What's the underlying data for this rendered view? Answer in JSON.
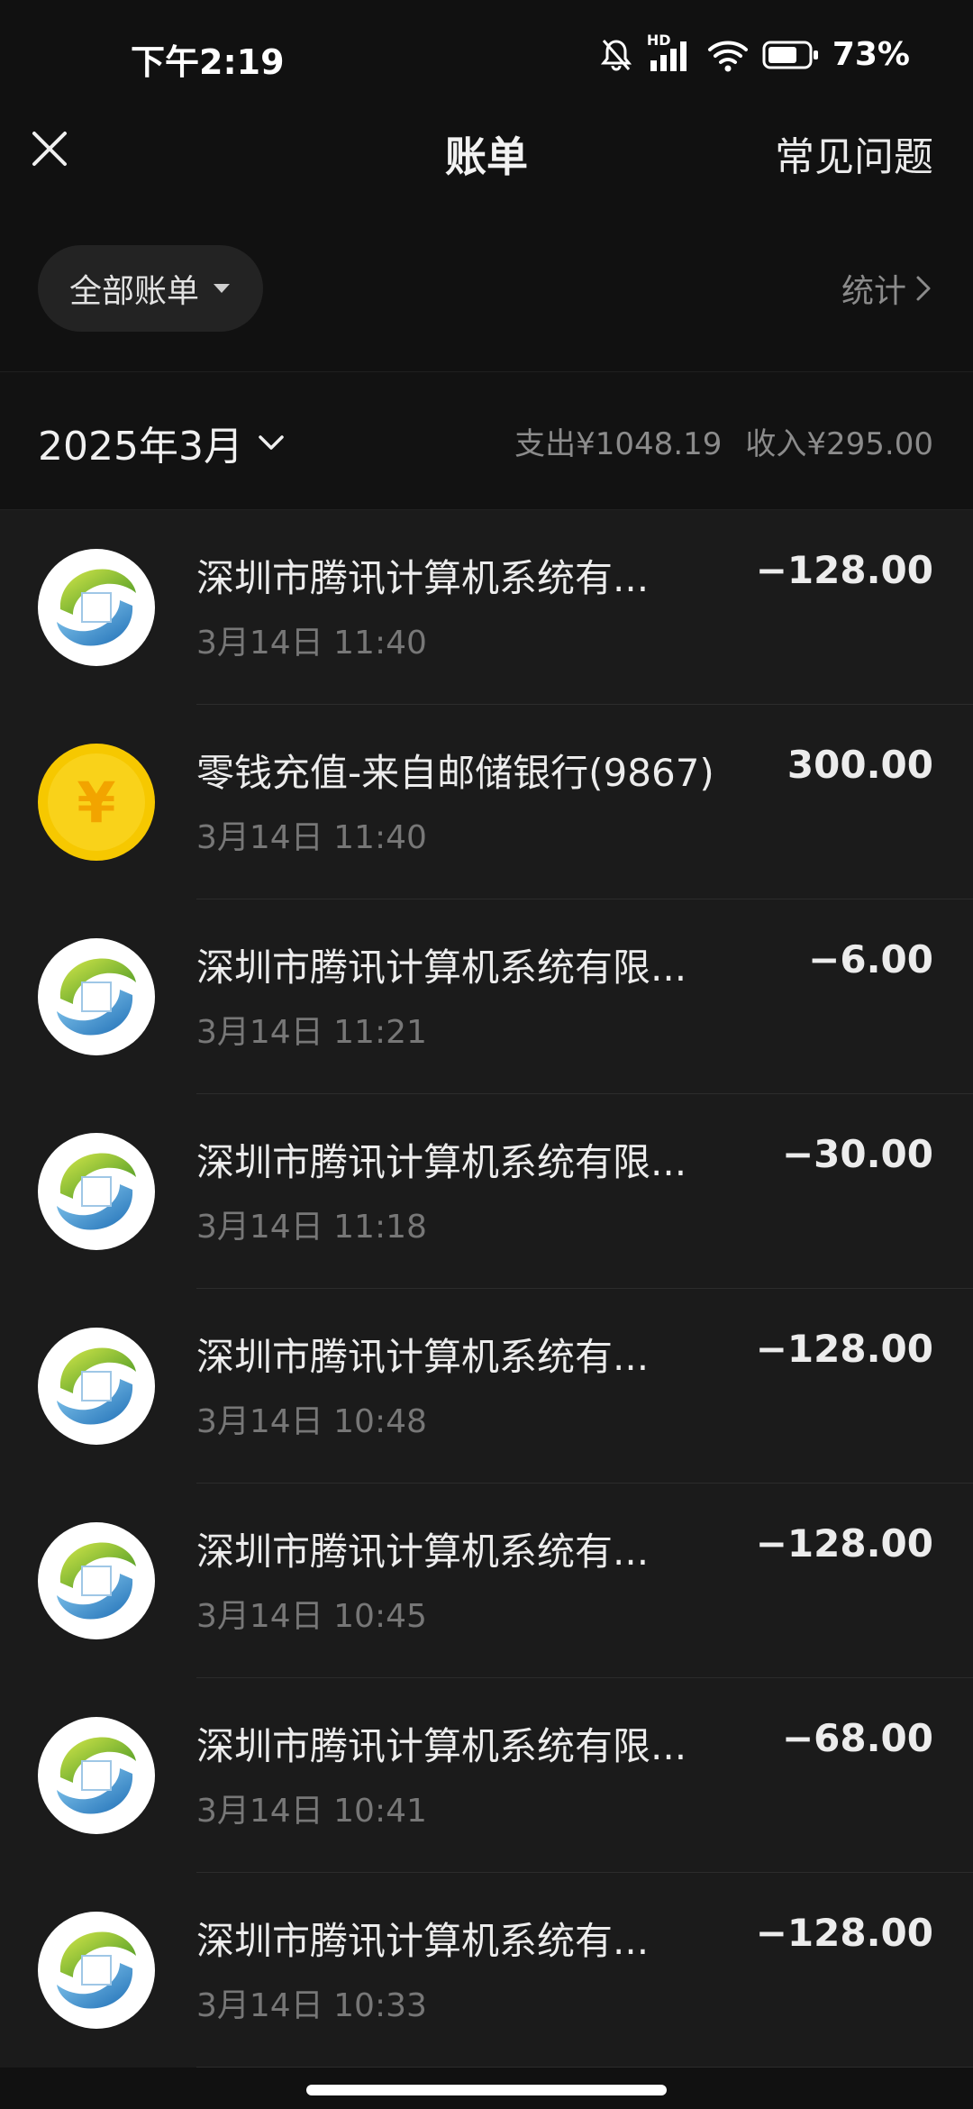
{
  "status_bar": {
    "time": "下午2:19",
    "hd_label": "HD",
    "battery_percent": "73%",
    "battery_level": 0.73
  },
  "header": {
    "title": "账单",
    "faq": "常见问题"
  },
  "filter": {
    "label": "全部账单",
    "stats": "统计"
  },
  "month": {
    "label": "2025年3月",
    "expense": "支出¥1048.19",
    "income": "收入¥295.00"
  },
  "transactions": [
    {
      "title": "深圳市腾讯计算机系统有...",
      "time": "3月14日 11:40",
      "amount": "−128.00",
      "icon": "merchant-logo-icon"
    },
    {
      "title": "零钱充值-来自邮储银行(9867)",
      "time": "3月14日 11:40",
      "amount": "300.00",
      "icon": "yuan-coin-icon",
      "coin_symbol": "¥"
    },
    {
      "title": "深圳市腾讯计算机系统有限...",
      "time": "3月14日 11:21",
      "amount": "−6.00",
      "icon": "merchant-logo-icon"
    },
    {
      "title": "深圳市腾讯计算机系统有限...",
      "time": "3月14日 11:18",
      "amount": "−30.00",
      "icon": "merchant-logo-icon"
    },
    {
      "title": "深圳市腾讯计算机系统有...",
      "time": "3月14日 10:48",
      "amount": "−128.00",
      "icon": "merchant-logo-icon"
    },
    {
      "title": "深圳市腾讯计算机系统有...",
      "time": "3月14日 10:45",
      "amount": "−128.00",
      "icon": "merchant-logo-icon"
    },
    {
      "title": "深圳市腾讯计算机系统有限...",
      "time": "3月14日 10:41",
      "amount": "−68.00",
      "icon": "merchant-logo-icon"
    },
    {
      "title": "深圳市腾讯计算机系统有...",
      "time": "3月14日 10:33",
      "amount": "−128.00",
      "icon": "merchant-logo-icon"
    }
  ],
  "colors": {
    "background": "#111111",
    "list_background": "#1b1b1b",
    "primary_text": "#ececec",
    "secondary_text": "#777777",
    "coin_yellow": "#f6c800"
  }
}
